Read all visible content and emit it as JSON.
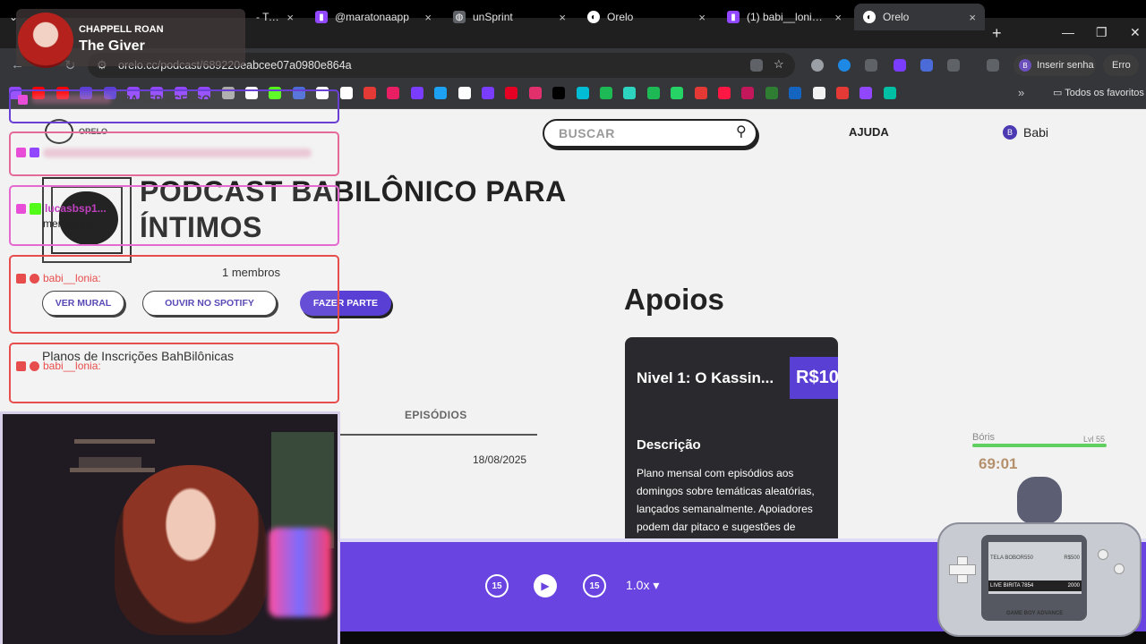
{
  "browser": {
    "tabs": [
      {
        "title": "- Twitch",
        "favicon_color": "#9146ff",
        "active": false
      },
      {
        "title": "@maratonaapp",
        "favicon_color": "#9146ff",
        "active": false
      },
      {
        "title": "unSprint",
        "favicon_color": "#8ab4f8",
        "active": false
      },
      {
        "title": "Orelo",
        "favicon_color": "#ffffff",
        "active": false
      },
      {
        "title": "(1) babi__lonia - Twitch",
        "favicon_color": "#9146ff",
        "active": false
      },
      {
        "title": "Orelo",
        "favicon_color": "#ffffff",
        "active": true
      }
    ],
    "close_glyph": "×",
    "new_tab_glyph": "+",
    "window_controls": {
      "minimize": "—",
      "maximize": "❐",
      "close": "✕"
    },
    "url": "orelo.cc/podcast/689220eabcee07a0980e864a",
    "profile_initial": "B",
    "login_label": "Inserir senha",
    "error_label": "Erro",
    "more_bookmarks": "»",
    "all_bookmarks_label": "Todos os favoritos",
    "bookmark_colors": [
      "#9146ff",
      "#ff0000",
      "#ff0000",
      "#5a3fd4",
      "#5a3fd4",
      "#9146ff",
      "#9146ff",
      "#9146ff",
      "#9146ff",
      "#aaaaaa",
      "#ffffff",
      "#53fc18",
      "#4b6bd8",
      "#ffffff",
      "#ffffff",
      "#e53935",
      "#e91e63",
      "#7a3cff",
      "#1da1f2",
      "#ffffff",
      "#7a3cff",
      "#e60023",
      "#e1306c",
      "#000000",
      "#00bcd4",
      "#1db954",
      "#2dd4bf",
      "#1db954",
      "#25d366",
      "#e53935",
      "#ff1744",
      "#c2185b",
      "#2e7d32",
      "#1565c0",
      "#f2f2f2",
      "#e53935",
      "#9146ff",
      "#00bfa5"
    ]
  },
  "page": {
    "search_placeholder": "BUSCAR",
    "help_label": "AJUDA",
    "user": {
      "initial": "B",
      "name": "Babi"
    },
    "logo_text": "ORELO",
    "podcast_title_line1": "PODCAST BABILÔNICO PARA",
    "podcast_title_line2": "ÍNTIMOS",
    "members": "1 membros",
    "buttons": {
      "mural": "VER MURAL",
      "spotify": "OUVIR NO SPOTIFY",
      "join": "FAZER PARTE"
    },
    "plans_heading": "Planos de Inscrições BahBilônicas",
    "episodes_tab": "EPISÓDIOS",
    "episode_date": "18/08/2025",
    "apoios_heading": "Apoios",
    "tier": {
      "title": "Nivel 1: O Kassin...",
      "price": "R$10",
      "desc_heading": "Descrição",
      "desc": "Plano mensal com episódios aos domingos sobre temáticas aleatórias, lançados semanalmente. Apoiadores podem dar pitaco e sugestões de"
    }
  },
  "player": {
    "rewind": "15",
    "forward": "15",
    "speed": "1.0x ▾"
  },
  "overlay": {
    "music": {
      "artist": "CHAPPELL ROAN",
      "song": "The Giver"
    },
    "chat": [
      {
        "user": "",
        "text": "PRA TER ACESSO?",
        "color": "#6a3fd4"
      },
      {
        "user": "lucasbsp1...",
        "text": "membrana",
        "color": "#c040c0"
      },
      {
        "user": "babi__lonia:",
        "text": "",
        "color": "#e84d4d"
      },
      {
        "user": "babi__lonia:",
        "text": "",
        "color": "#e84d4d"
      }
    ],
    "pet": {
      "name": "Bóris",
      "level": "Lvl 55",
      "timer": "69:01",
      "health_fraction": 1.0
    },
    "console": {
      "row1_left": "TELA BOBOR550",
      "row1_right": "R$500",
      "row2_left": "LIVE BIRITA 7854",
      "row2_right": "2000",
      "brand": "GAME BOY ADVANCE"
    }
  }
}
